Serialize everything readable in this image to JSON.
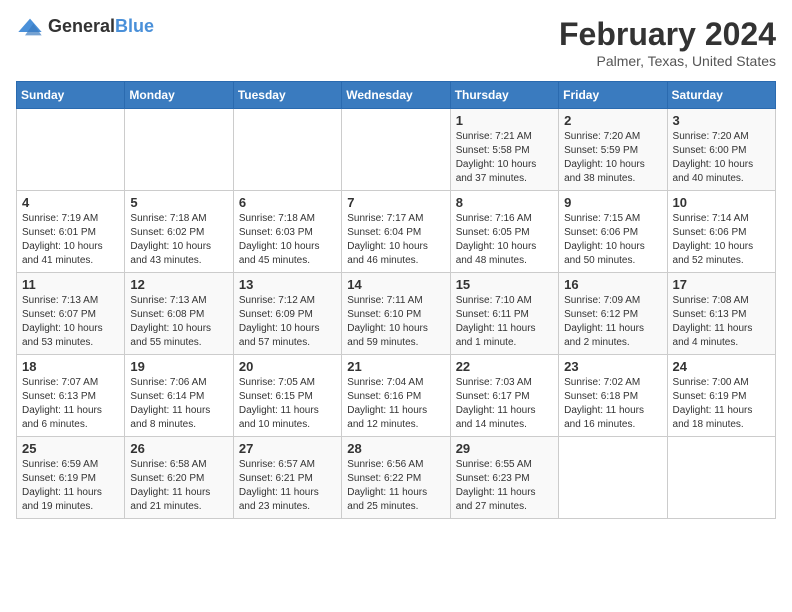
{
  "logo": {
    "general": "General",
    "blue": "Blue"
  },
  "title": {
    "month_year": "February 2024",
    "location": "Palmer, Texas, United States"
  },
  "headers": [
    "Sunday",
    "Monday",
    "Tuesday",
    "Wednesday",
    "Thursday",
    "Friday",
    "Saturday"
  ],
  "weeks": [
    [
      {
        "day": "",
        "info": ""
      },
      {
        "day": "",
        "info": ""
      },
      {
        "day": "",
        "info": ""
      },
      {
        "day": "",
        "info": ""
      },
      {
        "day": "1",
        "info": "Sunrise: 7:21 AM\nSunset: 5:58 PM\nDaylight: 10 hours\nand 37 minutes."
      },
      {
        "day": "2",
        "info": "Sunrise: 7:20 AM\nSunset: 5:59 PM\nDaylight: 10 hours\nand 38 minutes."
      },
      {
        "day": "3",
        "info": "Sunrise: 7:20 AM\nSunset: 6:00 PM\nDaylight: 10 hours\nand 40 minutes."
      }
    ],
    [
      {
        "day": "4",
        "info": "Sunrise: 7:19 AM\nSunset: 6:01 PM\nDaylight: 10 hours\nand 41 minutes."
      },
      {
        "day": "5",
        "info": "Sunrise: 7:18 AM\nSunset: 6:02 PM\nDaylight: 10 hours\nand 43 minutes."
      },
      {
        "day": "6",
        "info": "Sunrise: 7:18 AM\nSunset: 6:03 PM\nDaylight: 10 hours\nand 45 minutes."
      },
      {
        "day": "7",
        "info": "Sunrise: 7:17 AM\nSunset: 6:04 PM\nDaylight: 10 hours\nand 46 minutes."
      },
      {
        "day": "8",
        "info": "Sunrise: 7:16 AM\nSunset: 6:05 PM\nDaylight: 10 hours\nand 48 minutes."
      },
      {
        "day": "9",
        "info": "Sunrise: 7:15 AM\nSunset: 6:06 PM\nDaylight: 10 hours\nand 50 minutes."
      },
      {
        "day": "10",
        "info": "Sunrise: 7:14 AM\nSunset: 6:06 PM\nDaylight: 10 hours\nand 52 minutes."
      }
    ],
    [
      {
        "day": "11",
        "info": "Sunrise: 7:13 AM\nSunset: 6:07 PM\nDaylight: 10 hours\nand 53 minutes."
      },
      {
        "day": "12",
        "info": "Sunrise: 7:13 AM\nSunset: 6:08 PM\nDaylight: 10 hours\nand 55 minutes."
      },
      {
        "day": "13",
        "info": "Sunrise: 7:12 AM\nSunset: 6:09 PM\nDaylight: 10 hours\nand 57 minutes."
      },
      {
        "day": "14",
        "info": "Sunrise: 7:11 AM\nSunset: 6:10 PM\nDaylight: 10 hours\nand 59 minutes."
      },
      {
        "day": "15",
        "info": "Sunrise: 7:10 AM\nSunset: 6:11 PM\nDaylight: 11 hours\nand 1 minute."
      },
      {
        "day": "16",
        "info": "Sunrise: 7:09 AM\nSunset: 6:12 PM\nDaylight: 11 hours\nand 2 minutes."
      },
      {
        "day": "17",
        "info": "Sunrise: 7:08 AM\nSunset: 6:13 PM\nDaylight: 11 hours\nand 4 minutes."
      }
    ],
    [
      {
        "day": "18",
        "info": "Sunrise: 7:07 AM\nSunset: 6:13 PM\nDaylight: 11 hours\nand 6 minutes."
      },
      {
        "day": "19",
        "info": "Sunrise: 7:06 AM\nSunset: 6:14 PM\nDaylight: 11 hours\nand 8 minutes."
      },
      {
        "day": "20",
        "info": "Sunrise: 7:05 AM\nSunset: 6:15 PM\nDaylight: 11 hours\nand 10 minutes."
      },
      {
        "day": "21",
        "info": "Sunrise: 7:04 AM\nSunset: 6:16 PM\nDaylight: 11 hours\nand 12 minutes."
      },
      {
        "day": "22",
        "info": "Sunrise: 7:03 AM\nSunset: 6:17 PM\nDaylight: 11 hours\nand 14 minutes."
      },
      {
        "day": "23",
        "info": "Sunrise: 7:02 AM\nSunset: 6:18 PM\nDaylight: 11 hours\nand 16 minutes."
      },
      {
        "day": "24",
        "info": "Sunrise: 7:00 AM\nSunset: 6:19 PM\nDaylight: 11 hours\nand 18 minutes."
      }
    ],
    [
      {
        "day": "25",
        "info": "Sunrise: 6:59 AM\nSunset: 6:19 PM\nDaylight: 11 hours\nand 19 minutes."
      },
      {
        "day": "26",
        "info": "Sunrise: 6:58 AM\nSunset: 6:20 PM\nDaylight: 11 hours\nand 21 minutes."
      },
      {
        "day": "27",
        "info": "Sunrise: 6:57 AM\nSunset: 6:21 PM\nDaylight: 11 hours\nand 23 minutes."
      },
      {
        "day": "28",
        "info": "Sunrise: 6:56 AM\nSunset: 6:22 PM\nDaylight: 11 hours\nand 25 minutes."
      },
      {
        "day": "29",
        "info": "Sunrise: 6:55 AM\nSunset: 6:23 PM\nDaylight: 11 hours\nand 27 minutes."
      },
      {
        "day": "",
        "info": ""
      },
      {
        "day": "",
        "info": ""
      }
    ]
  ]
}
